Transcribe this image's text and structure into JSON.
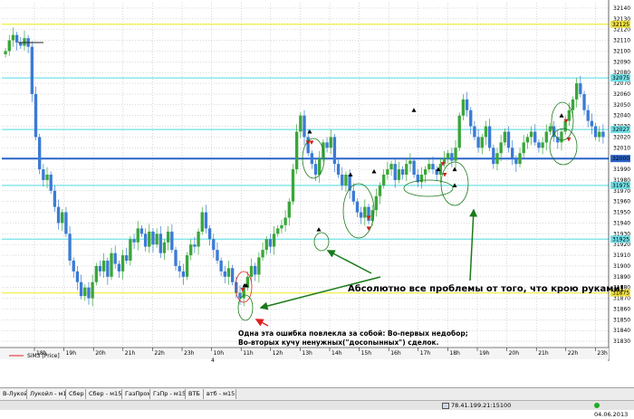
{
  "chart_data": {
    "type": "candlestick",
    "instrument_label": "SiM3 [Price]",
    "y_tick_labels": [
      "32140",
      "32130",
      "32120",
      "32110",
      "32100",
      "32090",
      "32080",
      "32070",
      "32060",
      "32050",
      "32040",
      "32030",
      "32020",
      "32010",
      "32000",
      "31990",
      "31980",
      "31970",
      "31960",
      "31950",
      "31940",
      "31930",
      "31920",
      "31910",
      "31900",
      "31890",
      "31880",
      "31870",
      "31860",
      "31850",
      "31840",
      "31830"
    ],
    "ylim": [
      31825,
      32145
    ],
    "x_tick_labels": [
      "18h",
      "19h",
      "20h",
      "21h",
      "22h",
      "23h",
      "10h",
      "11h",
      "12h",
      "13h",
      "14h",
      "15h",
      "16h",
      "17h",
      "18h",
      "19h",
      "20h",
      "21h",
      "22h",
      "23h"
    ],
    "day_label": "4",
    "yellow_levels": [
      32125,
      31875
    ],
    "cyan_levels": [
      32075,
      32027,
      31975,
      31925
    ],
    "blue_level": 32000,
    "highlighted_price_labels": [
      "32125",
      "32075",
      "32027",
      "32000",
      "31975",
      "31925",
      "31875"
    ],
    "close_prices": [
      32100,
      32110,
      32115,
      32108,
      32105,
      32112,
      32104,
      32060,
      32020,
      31990,
      31980,
      31985,
      31970,
      31955,
      31940,
      31950,
      31930,
      31905,
      31895,
      31885,
      31872,
      31880,
      31870,
      31885,
      31900,
      31895,
      31905,
      31890,
      31912,
      31902,
      31895,
      31910,
      31905,
      31925,
      31922,
      31935,
      31930,
      31918,
      31932,
      31920,
      31930,
      31912,
      31922,
      31932,
      31915,
      31900,
      31895,
      31890,
      31910,
      31920,
      31918,
      31932,
      31950,
      31935,
      31925,
      31915,
      31905,
      31895,
      31890,
      31898,
      31885,
      31875,
      31870,
      31880,
      31890,
      31900,
      31892,
      31908,
      31915,
      31925,
      31918,
      31930,
      31935,
      31938,
      31945,
      31960,
      31990,
      32025,
      32040,
      32020,
      32005,
      31995,
      31985,
      32000,
      32015,
      32010,
      32020,
      31995,
      31985,
      31975,
      31985,
      31970,
      31960,
      31950,
      31945,
      31955,
      31942,
      31952,
      31965,
      31975,
      31985,
      31990,
      31995,
      31980,
      31990,
      31985,
      31995,
      31998,
      31985,
      31978,
      31985,
      31990,
      31995,
      31990,
      31985,
      31995,
      32000,
      32005,
      31998,
      32010,
      32040,
      32055,
      32045,
      32030,
      32020,
      32010,
      32020,
      32030,
      32010,
      31995,
      32005,
      32015,
      32025,
      32010,
      32000,
      31995,
      32005,
      32015,
      32020,
      32025,
      32015,
      32010,
      32015,
      32025,
      32030,
      32020,
      32015,
      32025,
      32035,
      32045,
      32055,
      32070,
      32060,
      32045,
      32035,
      32030,
      32020,
      32025,
      32020
    ],
    "series": [
      {
        "name": "buy markers",
        "values": [
          32025,
          31985,
          31882,
          31934,
          31882,
          31975,
          31990,
          31990,
          31988,
          32040,
          32045
        ]
      },
      {
        "name": "sell markers",
        "values": [
          32015,
          31945,
          31935,
          31995,
          32015,
          32035,
          32018,
          31985,
          31878
        ]
      }
    ]
  },
  "annotations": {
    "main_text": "Абсолютно все проблемы от того, что крою руками!",
    "note_line1": "Одна эта ошибка повлекла за собой:  Во-первых недобор;",
    "note_line2": "Во-вторых кучу ненужных(\"досоnынных\") сделок."
  },
  "tabs": [
    "В-Лукойл",
    "Лукойл - м15",
    "Сбер",
    "Сбер - м15",
    "ГазПром",
    "ГзПр - м15",
    "ВТБ",
    "втб - м15"
  ],
  "status": {
    "connection": "78.41.199.21:15100",
    "date": "04.06.2013"
  },
  "colors": {
    "bull": "#3aa63a",
    "bear": "#3b7bd4",
    "yellow_line": "#f0f060",
    "cyan_line": "#70e0e8",
    "blue_line": "#2a64c8",
    "annotation": "#1a7a1a",
    "error_marker": "#e02020"
  }
}
